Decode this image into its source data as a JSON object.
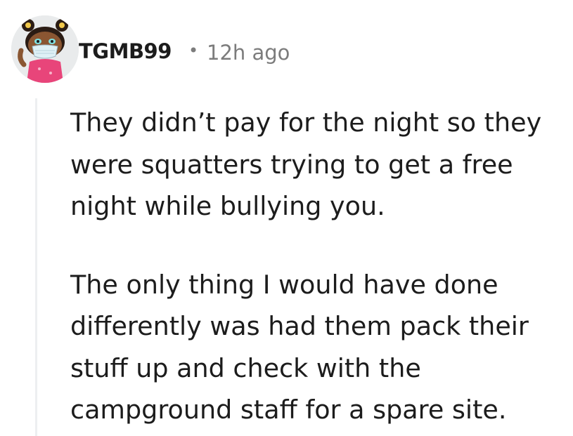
{
  "comment": {
    "author": "TGMB99",
    "separator": "•",
    "timestamp": "12h ago",
    "avatar": "snoo-avatar-with-mask-icon",
    "paragraphs": [
      "They didn’t pay for the night so they\nwere squatters trying to get a free\nnight while bullying you.",
      "The only thing I would have done\ndifferently was had them pack their\nstuff up and check with the\ncampground staff for a spare site."
    ]
  },
  "colors": {
    "text": "#1c1c1c",
    "meta": "#7c7c7c",
    "thread_line": "#edeff1",
    "avatar_bg": "#e9ebec",
    "shirt": "#e8457a",
    "skin": "#8a5632",
    "hair": "#2b1c14",
    "mask": "#dff1f6"
  }
}
